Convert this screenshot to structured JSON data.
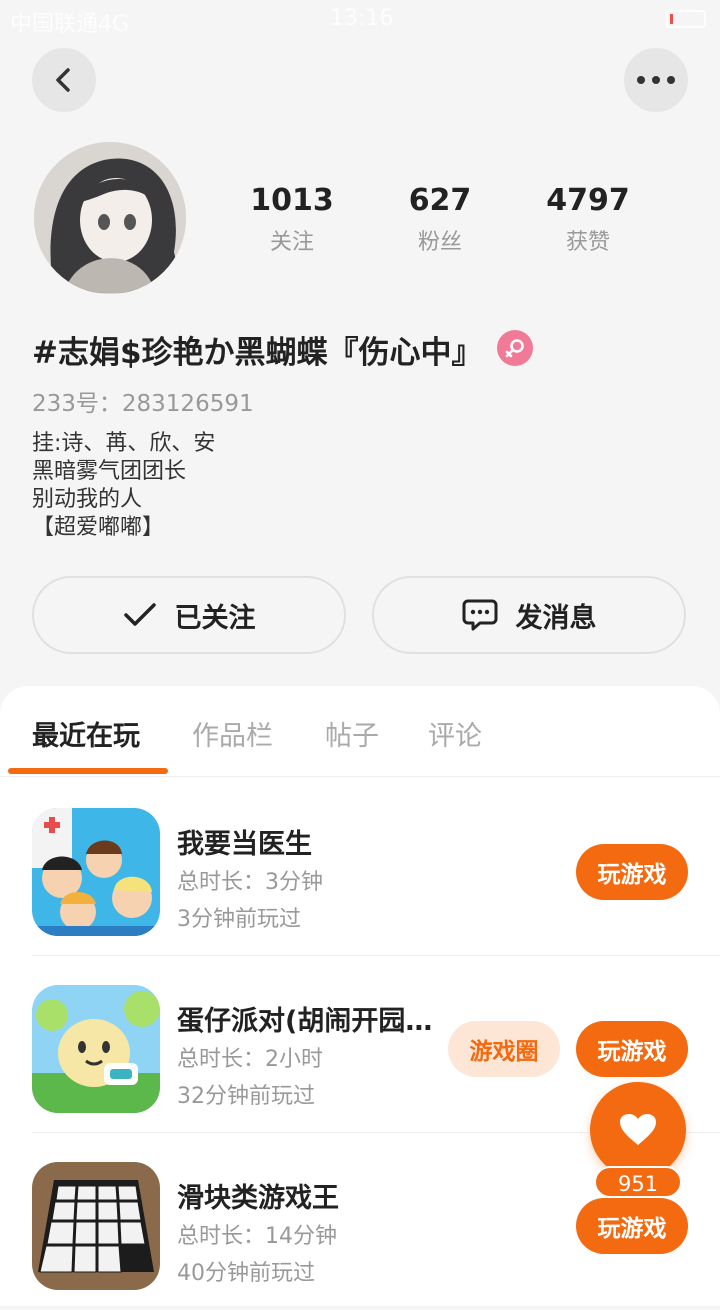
{
  "status_bar": {
    "carrier": "中国联通4G",
    "time": "13:16"
  },
  "profile": {
    "stats": [
      {
        "value": "1013",
        "label": "关注"
      },
      {
        "value": "627",
        "label": "粉丝"
      },
      {
        "value": "4797",
        "label": "获赞"
      }
    ],
    "nickname": "#志娟$珍艳か黑蝴蝶『伤心中』",
    "gender": "female",
    "uid": "233号：283126591",
    "bio_lines": [
      "挂:诗、苒、欣、安",
      "黑暗雾气团团长",
      "别动我的人",
      "【超爱嘟嘟】"
    ]
  },
  "actions": {
    "follow_label": "已关注",
    "message_label": "发消息"
  },
  "tabs": [
    "最近在玩",
    "作品栏",
    "帖子",
    "评论"
  ],
  "games": [
    {
      "name": "我要当医生",
      "duration": "总时长：3分钟",
      "last_played": "3分钟前玩过",
      "play_label": "玩游戏",
      "icon": "doctor-game-icon"
    },
    {
      "name": "蛋仔派对(胡闹开园…",
      "duration": "总时长：2小时",
      "last_played": "32分钟前玩过",
      "play_label": "玩游戏",
      "circle_label": "游戏圈",
      "icon": "eggy-party-icon"
    },
    {
      "name": "滑块类游戏王",
      "duration": "总时长：14分钟",
      "last_played": "40分钟前玩过",
      "play_label": "玩游戏",
      "icon": "slider-puzzle-icon"
    }
  ],
  "like": {
    "count": "951"
  },
  "colors": {
    "accent": "#f46a10",
    "accent_light": "#fde6d6",
    "female_badge": "#f07a97"
  }
}
